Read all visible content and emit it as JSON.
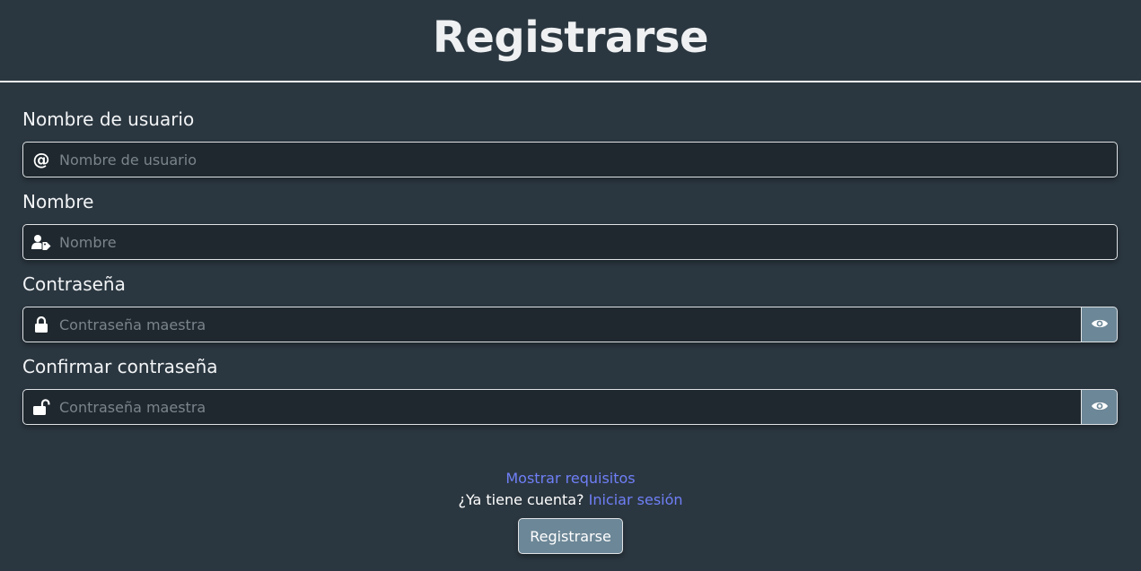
{
  "page": {
    "title": "Registrarse"
  },
  "form": {
    "username": {
      "label": "Nombre de usuario",
      "placeholder": "Nombre de usuario",
      "value": "",
      "icon": "at-icon"
    },
    "name": {
      "label": "Nombre",
      "placeholder": "Nombre",
      "value": "",
      "icon": "user-tag-icon"
    },
    "password": {
      "label": "Contraseña",
      "placeholder": "Contraseña maestra",
      "value": "",
      "icon": "lock-icon",
      "toggle_icon": "eye-icon"
    },
    "confirm_password": {
      "label": "Confirmar contraseña",
      "placeholder": "Contraseña maestra",
      "value": "",
      "icon": "unlock-icon",
      "toggle_icon": "eye-icon"
    }
  },
  "footer": {
    "show_requirements": "Mostrar requisitos",
    "account_question": "¿Ya tiene cuenta?",
    "login_link": "Iniciar sesión",
    "submit_label": "Registrarse"
  },
  "colors": {
    "background": "#2b3740",
    "input_background": "#1f282e",
    "button": "#6c8797",
    "link": "#6f7ff7"
  }
}
